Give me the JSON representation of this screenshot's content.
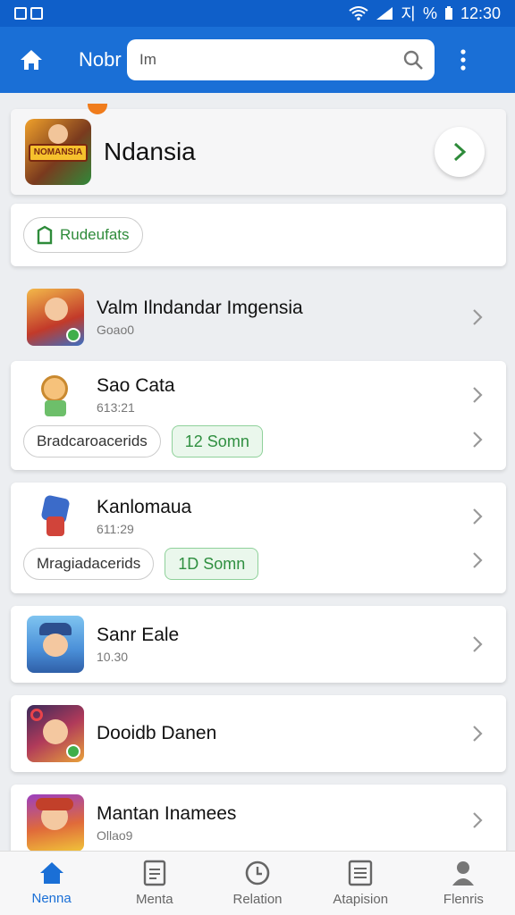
{
  "status": {
    "time": "12:30",
    "battery": "%",
    "signal_text": "지"
  },
  "appbar": {
    "title": "Nobr",
    "search_value": "Im"
  },
  "featured": {
    "title": "Ndansia",
    "thumb_caption": "NOMANSIA"
  },
  "filter": {
    "chip_label": "Rudeufats"
  },
  "items": [
    {
      "name": "Valm Ilndandar Imgensia",
      "sub": "Goao0"
    },
    {
      "name": "Sao Cata",
      "sub": "613:21",
      "chip": "Bradcaroacerids",
      "tag": "12 Somn"
    },
    {
      "name": "Kanlomaua",
      "sub": "611:29",
      "chip": "Mragiadacerids",
      "tag": "1D Somn"
    },
    {
      "name": "Sanr Eale",
      "sub": "10.30"
    },
    {
      "name": "Dooidb Danen",
      "sub": ""
    },
    {
      "name": "Mantan Inamees",
      "sub": "Ollao9"
    }
  ],
  "nav": [
    {
      "label": "Nenna",
      "icon": "home-icon"
    },
    {
      "label": "Menta",
      "icon": "document-icon"
    },
    {
      "label": "Relation",
      "icon": "clock-icon"
    },
    {
      "label": "Atapision",
      "icon": "list-icon"
    },
    {
      "label": "Flenris",
      "icon": "person-icon"
    }
  ],
  "colors": {
    "primary": "#1a6fd6",
    "statusbar": "#0f5fc9",
    "accent_green": "#2f8f40"
  }
}
